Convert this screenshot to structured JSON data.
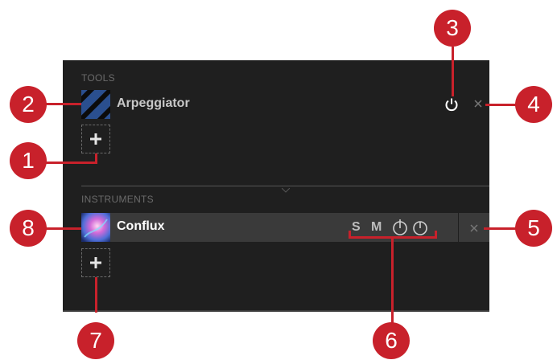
{
  "tools": {
    "label": "TOOLS",
    "item": {
      "name": "Arpeggiator"
    }
  },
  "instruments": {
    "label": "INSTRUMENTS",
    "item": {
      "name": "Conflux",
      "solo": "S",
      "mute": "M"
    }
  },
  "callouts": [
    "1",
    "2",
    "3",
    "4",
    "5",
    "6",
    "7",
    "8"
  ],
  "colors": {
    "callout": "#c8212b",
    "panel": "#1f1f1f",
    "row": "#3a3a3a"
  }
}
